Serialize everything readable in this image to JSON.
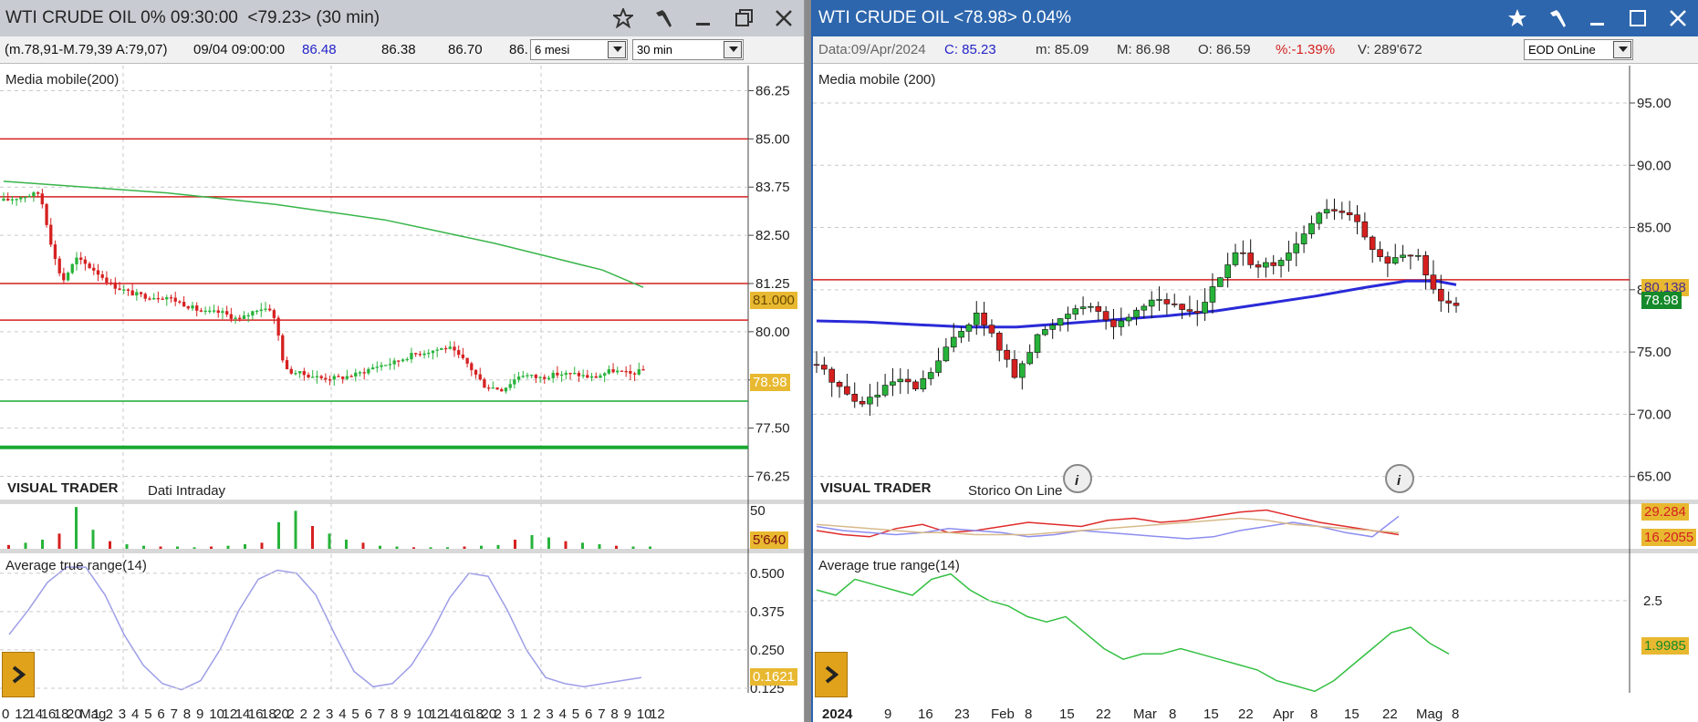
{
  "left": {
    "title": "WTI CRUDE OIL 0% 09:30:00  <79.23> (30 min)",
    "info": {
      "range": "(m.78,91-M.79,39 A:79,07)",
      "datetime": "09/04 09:00:00",
      "v1": "86.48",
      "v2": "86.38",
      "v3": "86.70",
      "v4": "86."
    },
    "period_select": "6 mesi",
    "interval_select": "30 min",
    "overlay_label": "Media mobile(200)",
    "brand": "VISUAL TRADER",
    "brand_sub": "Dati Intraday",
    "volume_axis_label": "50",
    "volume_value": "5'640",
    "atr_label": "Average true range(14)",
    "atr_value": "0.1621",
    "price_label_ma": "81.000",
    "price_label_last": "78.98",
    "colors": {
      "ma": "#38b54a",
      "hline_red": "#d42020",
      "hline_green": "#19a830",
      "atr": "#9d9de8",
      "up": "#27b33a",
      "down": "#d62020"
    }
  },
  "right": {
    "title": "WTI CRUDE OIL <78.98> 0.04%",
    "info": {
      "data": "Data:09/Apr/2024",
      "c": "C: 85.23",
      "m": "m: 85.09",
      "M": "M: 86.98",
      "O": "O: 86.59",
      "pct": "%:-1.39%",
      "v": "V: 289'672"
    },
    "source_select": "EOD OnLine",
    "overlay_label": "Media mobile (200)",
    "brand": "VISUAL TRADER",
    "brand_sub": "Storico On Line",
    "osc_val1": "29.284",
    "osc_val2": "16.2055",
    "atr_label": "Average true range(14)",
    "atr_value": "1.9985",
    "atr_tick": "2.5",
    "price_label_red": "80.138",
    "price_label_last": "78.98",
    "colors": {
      "ma": "#2a2ad8",
      "hline_red": "#d42020",
      "atr": "#35c043",
      "up": "#27b33a",
      "down": "#d62020"
    }
  },
  "chart_data": [
    {
      "type": "line",
      "title": "WTI CRUDE OIL (30 min)",
      "ylim": [
        75.6,
        86.9
      ],
      "yticks": [
        86.25,
        85.0,
        83.75,
        82.5,
        81.25,
        80.0,
        78.75,
        77.5,
        76.25
      ],
      "xticks": [
        "0",
        "12",
        "14",
        "16",
        "18",
        "20",
        "Mag",
        "1",
        "2",
        "3",
        "4",
        "5",
        "6",
        "7",
        "8",
        "9",
        "10",
        "12",
        "14",
        "16",
        "18",
        "20",
        "2",
        "2",
        "2",
        "3",
        "4",
        "5",
        "6",
        "7",
        "8",
        "9",
        "10",
        "12",
        "14",
        "16",
        "18",
        "20",
        "2",
        "3",
        "1",
        "2",
        "3",
        "4",
        "5",
        "6",
        "7",
        "8",
        "9",
        "10",
        "12"
      ],
      "hlines": [
        85.0,
        83.5,
        81.25,
        80.3,
        78.2,
        77.0
      ],
      "series": [
        {
          "name": "Media mobile(200)",
          "x": [
            0,
            60,
            120,
            180,
            240,
            300,
            360,
            420,
            480,
            540,
            600,
            660,
            705
          ],
          "values": [
            83.9,
            83.8,
            83.7,
            83.6,
            83.45,
            83.3,
            83.1,
            82.9,
            82.6,
            82.3,
            81.95,
            81.6,
            81.15
          ]
        },
        {
          "name": "Price",
          "x": [
            0,
            20,
            40,
            55,
            65,
            80,
            100,
            120,
            140,
            160,
            180,
            200,
            220,
            240,
            260,
            280,
            295,
            302,
            310,
            330,
            350,
            370,
            390,
            410,
            430,
            450,
            470,
            490,
            510,
            530,
            550,
            570,
            590,
            610,
            630,
            650,
            670,
            690,
            705
          ],
          "values": [
            83.4,
            83.5,
            83.6,
            82.0,
            81.3,
            81.9,
            81.6,
            81.2,
            81.0,
            80.9,
            80.9,
            80.7,
            80.5,
            80.5,
            80.3,
            80.6,
            80.6,
            80.0,
            79.0,
            78.9,
            78.8,
            78.8,
            78.9,
            79.1,
            79.2,
            79.4,
            79.5,
            79.6,
            79.2,
            78.6,
            78.5,
            78.9,
            78.8,
            78.9,
            78.9,
            78.8,
            79.0,
            78.9,
            79.0
          ]
        }
      ],
      "volume_ylim": [
        0,
        60
      ],
      "volume": [
        5,
        8,
        12,
        20,
        55,
        25,
        10,
        6,
        4,
        3,
        3,
        2,
        3,
        4,
        6,
        8,
        35,
        50,
        30,
        20,
        12,
        8,
        4,
        3,
        2,
        2,
        2,
        3,
        4,
        5,
        12,
        18,
        15,
        10,
        8,
        6,
        4,
        3,
        3
      ],
      "atr_yticks": [
        0.5,
        0.375,
        0.25,
        0.125
      ],
      "atr_ylim": [
        0.11,
        0.55
      ],
      "atr": [
        0.3,
        0.38,
        0.47,
        0.52,
        0.52,
        0.43,
        0.3,
        0.2,
        0.14,
        0.12,
        0.15,
        0.25,
        0.38,
        0.48,
        0.51,
        0.5,
        0.43,
        0.3,
        0.18,
        0.13,
        0.14,
        0.2,
        0.3,
        0.42,
        0.5,
        0.49,
        0.38,
        0.25,
        0.16,
        0.14,
        0.13,
        0.14,
        0.15,
        0.16
      ]
    },
    {
      "type": "line",
      "title": "WTI CRUDE OIL (EOD)",
      "ylim": [
        63.0,
        98.0
      ],
      "yticks": [
        95.0,
        90.0,
        85.0,
        80.0,
        75.0,
        70.0,
        65.0
      ],
      "xticks": [
        "2024",
        "9",
        "16",
        "23",
        "Feb",
        "8",
        "15",
        "22",
        "Mar",
        "8",
        "15",
        "22",
        "Apr",
        "8",
        "15",
        "22",
        "Mag",
        "8"
      ],
      "hlines": [
        80.8
      ],
      "series": [
        {
          "name": "Media mobile (200)",
          "x": [
            0,
            50,
            100,
            150,
            200,
            250,
            300,
            350,
            400,
            450,
            500,
            550,
            590,
            620,
            640
          ],
          "values": [
            77.5,
            77.4,
            77.2,
            77.0,
            77.0,
            77.3,
            77.6,
            77.9,
            78.3,
            78.9,
            79.5,
            80.2,
            80.7,
            80.7,
            80.4
          ]
        },
        {
          "name": "Price",
          "x": [
            0,
            20,
            40,
            60,
            80,
            100,
            120,
            140,
            160,
            180,
            200,
            220,
            240,
            260,
            280,
            300,
            320,
            340,
            360,
            380,
            400,
            420,
            440,
            460,
            480,
            500,
            520,
            540,
            560,
            580,
            600,
            620,
            640
          ],
          "values": [
            74.0,
            72.5,
            70.8,
            71.5,
            72.8,
            72.0,
            74.0,
            76.5,
            78.0,
            75.8,
            72.8,
            76.2,
            77.5,
            78.8,
            78.2,
            77.0,
            78.5,
            79.5,
            78.5,
            78.2,
            80.5,
            83.0,
            82.0,
            81.8,
            83.5,
            86.0,
            86.5,
            85.5,
            82.5,
            82.3,
            83.0,
            79.5,
            79.0
          ]
        }
      ],
      "oscillator": {
        "series": [
          {
            "name": "red",
            "values": [
              20,
              18,
              17,
              21,
              23,
              19,
              20,
              22,
              24,
              23,
              22,
              25,
              26,
              24,
              25,
              27,
              29,
              30,
              27,
              24,
              22,
              20,
              18
            ]
          },
          {
            "name": "blue",
            "values": [
              22,
              20,
              19,
              18,
              19,
              21,
              20,
              19,
              17,
              18,
              20,
              19,
              18,
              17,
              16,
              17,
              20,
              22,
              24,
              22,
              19,
              17,
              27
            ]
          },
          {
            "name": "tan",
            "values": [
              23,
              22,
              21,
              20,
              19,
              19,
              18,
              18,
              18,
              19,
              20,
              21,
              22,
              23,
              24,
              25,
              26,
              25,
              23,
              22,
              21,
              20,
              19
            ]
          }
        ],
        "ylim": [
          12,
          32
        ]
      },
      "atr_yticks": [
        2.5
      ],
      "atr_ylim": [
        1.55,
        2.9
      ],
      "atr": [
        2.6,
        2.55,
        2.7,
        2.65,
        2.6,
        2.55,
        2.7,
        2.75,
        2.6,
        2.5,
        2.45,
        2.35,
        2.3,
        2.35,
        2.2,
        2.05,
        1.95,
        2.0,
        2.0,
        2.05,
        2.0,
        1.95,
        1.9,
        1.85,
        1.75,
        1.7,
        1.65,
        1.75,
        1.9,
        2.05,
        2.2,
        2.25,
        2.1,
        2.0
      ]
    }
  ]
}
